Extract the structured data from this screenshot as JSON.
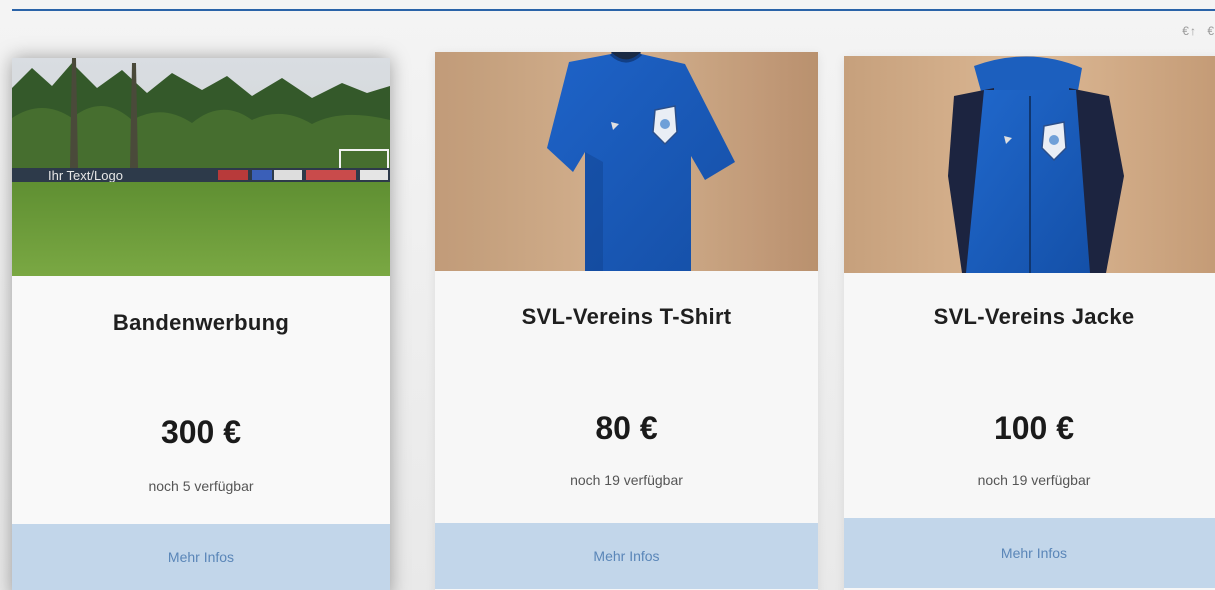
{
  "sort": {
    "price_asc": "€↑",
    "price_desc": "€"
  },
  "products": [
    {
      "title": "Bandenwerbung",
      "price": "300 €",
      "stock": "noch 5 verfügbar",
      "button": "Mehr Infos",
      "image_text": "Ihr Text/Logo"
    },
    {
      "title": "SVL-Vereins T-Shirt",
      "price": "80 €",
      "stock": "noch 19 verfügbar",
      "button": "Mehr Infos"
    },
    {
      "title": "SVL-Vereins Jacke",
      "price": "100 €",
      "stock": "noch 19 verfügbar",
      "button": "Mehr Infos"
    }
  ],
  "colors": {
    "accent": "#2a63a8",
    "button_bg": "#c2d6ea",
    "button_text": "#5a86b8"
  }
}
